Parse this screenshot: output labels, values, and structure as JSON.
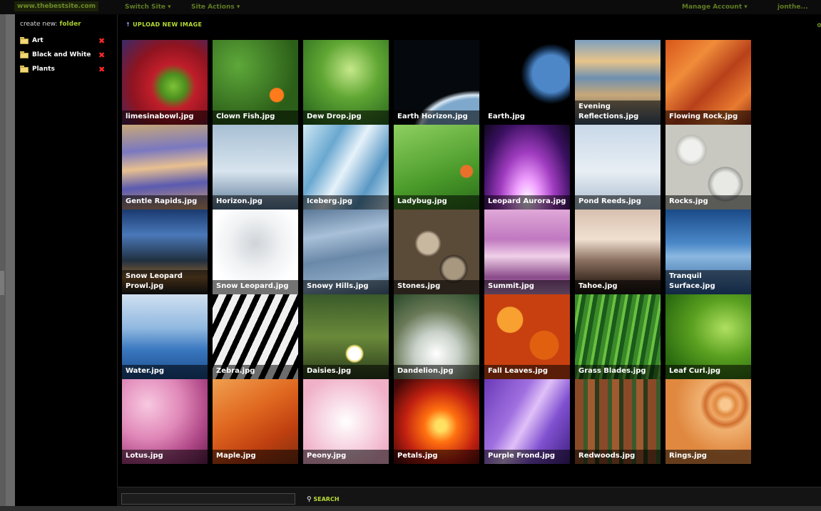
{
  "topbar": {
    "site_url": "www.thebestsite.com",
    "switch_site": "Switch Site",
    "site_actions": "Site Actions",
    "manage_account": "Manage Account",
    "username": "jonthe..."
  },
  "sidebar": {
    "create_new_label": "create new:",
    "create_new_link": "folder",
    "folders": [
      {
        "name": "Art"
      },
      {
        "name": "Black and White"
      },
      {
        "name": "Plants"
      }
    ]
  },
  "toolbar": {
    "upload_label": "UPLOAD NEW IMAGE"
  },
  "images": [
    {
      "name": "limesinabowl.jpg"
    },
    {
      "name": "Clown Fish.jpg"
    },
    {
      "name": "Dew Drop.jpg"
    },
    {
      "name": "Earth Horizon.jpg"
    },
    {
      "name": "Earth.jpg"
    },
    {
      "name": "Evening Reflections.jpg"
    },
    {
      "name": "Flowing Rock.jpg"
    },
    {
      "name": "Gentle Rapids.jpg"
    },
    {
      "name": "Horizon.jpg"
    },
    {
      "name": "Iceberg.jpg"
    },
    {
      "name": "Ladybug.jpg"
    },
    {
      "name": "Leopard Aurora.jpg"
    },
    {
      "name": "Pond Reeds.jpg"
    },
    {
      "name": "Rocks.jpg"
    },
    {
      "name": "Snow Leopard Prowl.jpg"
    },
    {
      "name": "Snow Leopard.jpg"
    },
    {
      "name": "Snowy Hills.jpg"
    },
    {
      "name": "Stones.jpg"
    },
    {
      "name": "Summit.jpg"
    },
    {
      "name": "Tahoe.jpg"
    },
    {
      "name": "Tranquil Surface.jpg"
    },
    {
      "name": "Water.jpg"
    },
    {
      "name": "Zebra.jpg"
    },
    {
      "name": "Daisies.jpg"
    },
    {
      "name": "Dandelion.jpg"
    },
    {
      "name": "Fall Leaves.jpg"
    },
    {
      "name": "Grass Blades.jpg"
    },
    {
      "name": "Leaf Curl.jpg"
    },
    {
      "name": "Lotus.jpg"
    },
    {
      "name": "Maple.jpg"
    },
    {
      "name": "Peony.jpg"
    },
    {
      "name": "Petals.jpg"
    },
    {
      "name": "Purple Frond.jpg"
    },
    {
      "name": "Redwoods.jpg"
    },
    {
      "name": "Rings.jpg"
    }
  ],
  "search": {
    "button_label": "SEARCH",
    "value": ""
  },
  "colors": {
    "accent": "#b7dc35",
    "delete": "#ff2a2a",
    "background": "#000000"
  }
}
